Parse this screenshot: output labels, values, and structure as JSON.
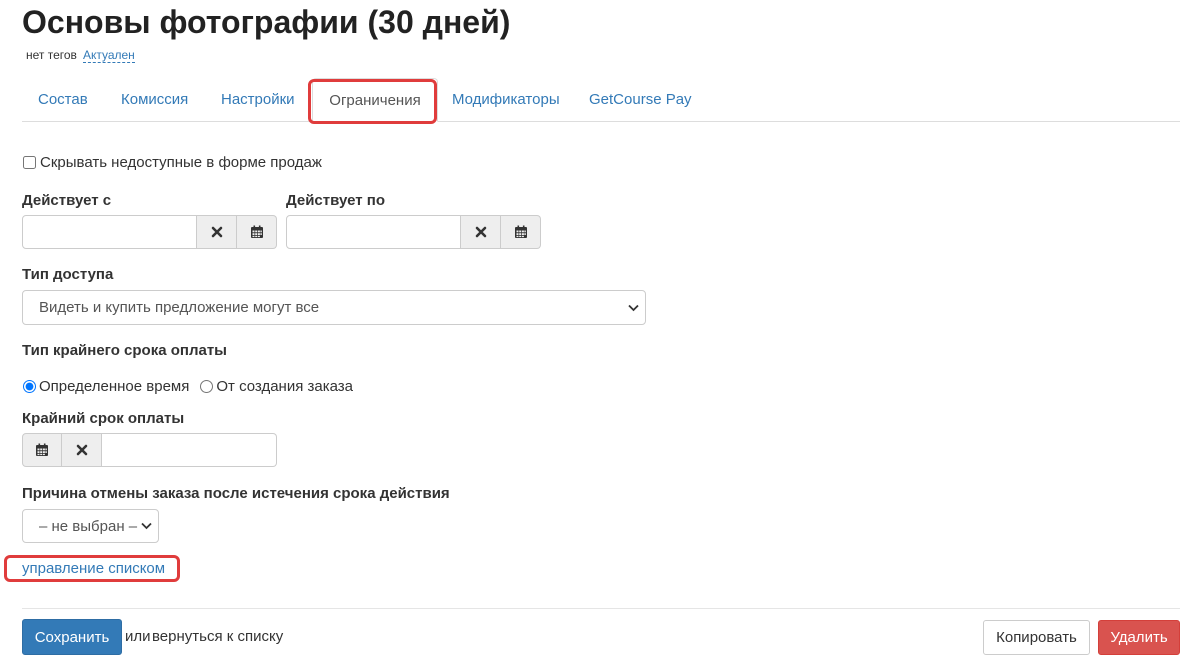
{
  "page": {
    "title": "Основы фотографии (30 дней)",
    "tags_text": "нет тегов",
    "status_link": "Актуален"
  },
  "tabs": [
    {
      "label": "Состав"
    },
    {
      "label": "Комиссия"
    },
    {
      "label": "Настройки"
    },
    {
      "label": "Ограничения",
      "active": true
    },
    {
      "label": "Модификаторы"
    },
    {
      "label": "GetCourse Pay"
    }
  ],
  "form": {
    "hide_unavailable_label": "Скрывать недоступные в форме продаж",
    "hide_unavailable_checked": false,
    "valid_from_label": "Действует с",
    "valid_from_value": "",
    "valid_to_label": "Действует по",
    "valid_to_value": "",
    "access_type_label": "Тип доступа",
    "access_type_value": "Видеть и купить предложение могут все",
    "deadline_type_label": "Тип крайнего срока оплаты",
    "deadline_options": [
      {
        "label": "Определенное время",
        "checked": true
      },
      {
        "label": "От создания заказа",
        "checked": false
      }
    ],
    "deadline_label": "Крайний срок оплаты",
    "deadline_value": "",
    "cancel_reason_label": "Причина отмены заказа после истечения срока действия",
    "cancel_reason_value": "– не выбран –",
    "manage_list_link": "управление списком"
  },
  "footer": {
    "save_label": "Сохранить",
    "or_text": "или",
    "back_link": "вернуться к списку",
    "copy_label": "Копировать",
    "delete_label": "Удалить"
  },
  "icons": {
    "clear": "times-icon",
    "calendar": "calendar-icon",
    "dropdown": "chevron-down-icon"
  },
  "colors": {
    "link": "#337ab7",
    "primary": "#337ab7",
    "danger": "#d9534f",
    "highlight": "#e03c3c"
  }
}
